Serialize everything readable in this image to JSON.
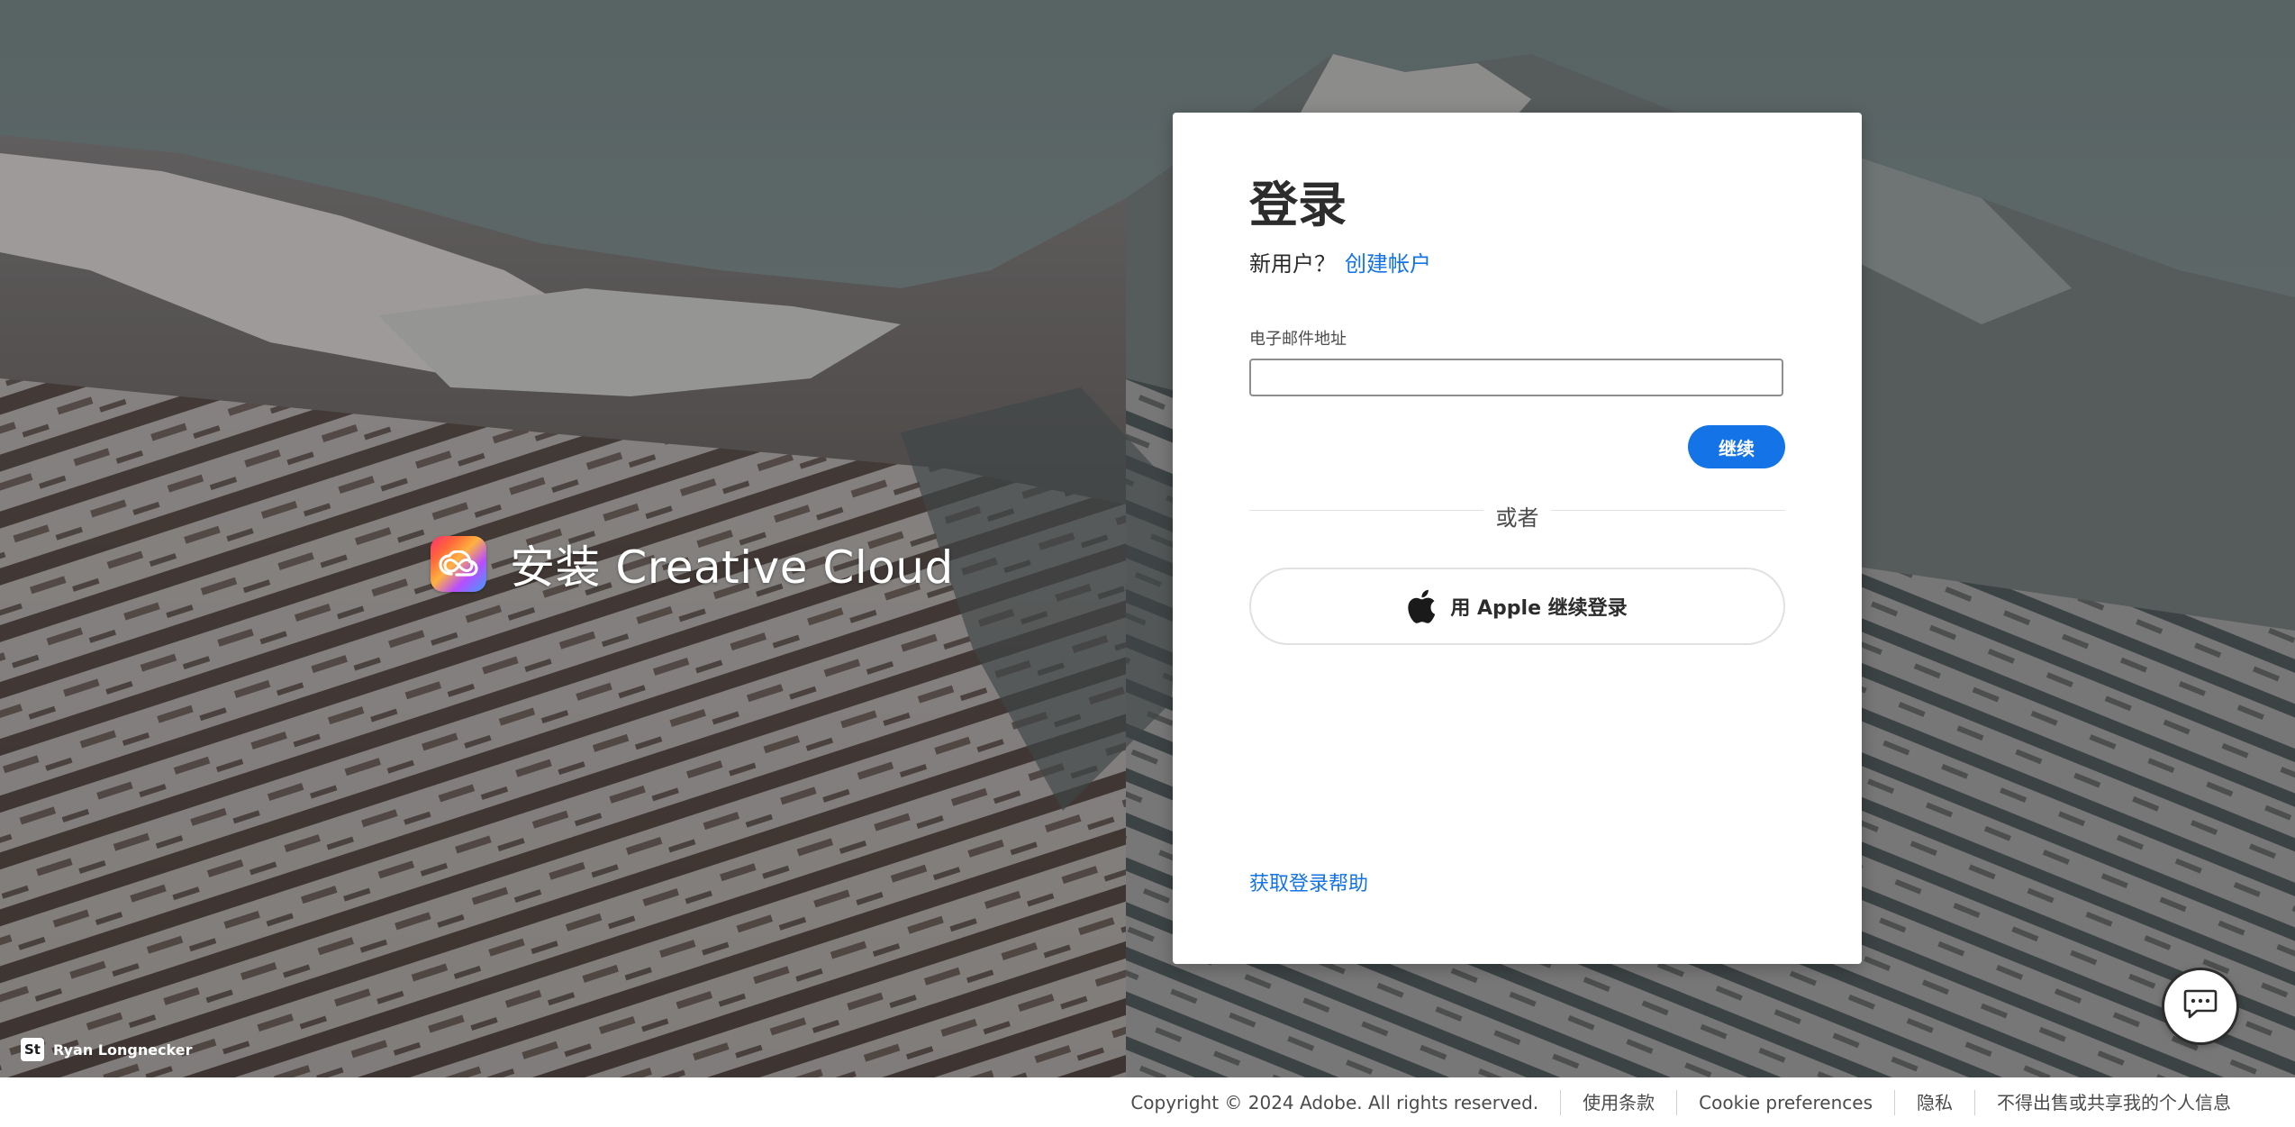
{
  "brand": {
    "title": "安装 Creative Cloud",
    "logo_icon": "creative-cloud-icon"
  },
  "login": {
    "title": "登录",
    "new_user_prefix": "新用户？",
    "create_account_link": "创建帐户",
    "email_label": "电子邮件地址",
    "email_value": "",
    "continue_label": "继续",
    "or_label": "或者",
    "apple_button_label": "用 Apple 继续登录",
    "help_link": "获取登录帮助"
  },
  "credit": {
    "badge": "St",
    "photographer": "Ryan Longnecker"
  },
  "chat": {
    "icon": "chat-bubble-icon"
  },
  "footer": {
    "copyright": "Copyright © 2024 Adobe. All rights reserved.",
    "terms": "使用条款",
    "cookies": "Cookie preferences",
    "privacy": "隐私",
    "do_not_sell": "不得出售或共享我的个人信息"
  },
  "colors": {
    "accent": "#1473e6",
    "card_bg": "#ffffff",
    "text": "#2c2c2c",
    "sky": "#6e7b7c",
    "snow": "#c9c6c4"
  }
}
